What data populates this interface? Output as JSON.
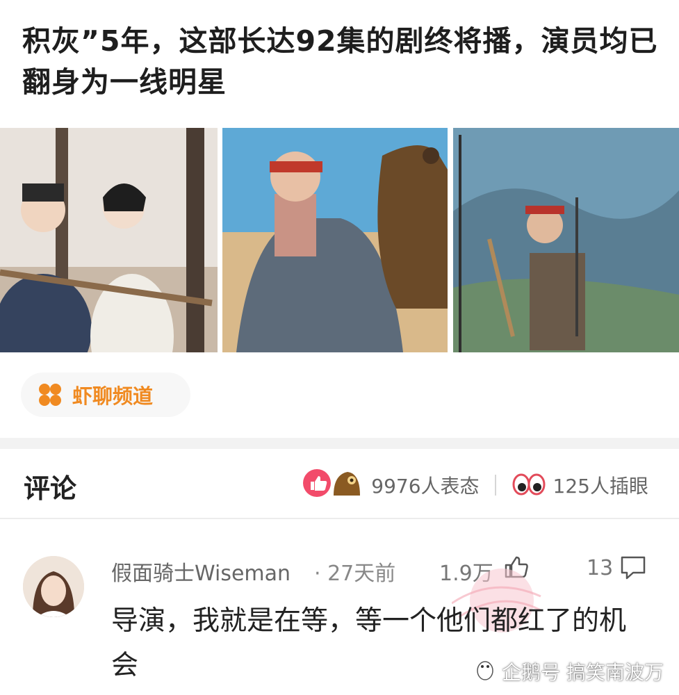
{
  "article": {
    "title": "积灰”5年，这部长达92集的剧终将播，演员均已翻身为一线明星"
  },
  "gallery": {
    "photos": [
      "photo-duo-armor",
      "photo-eagle-warrior",
      "photo-mountain-archer"
    ]
  },
  "channel": {
    "name": "虾聊频道",
    "icon": "four-petal-icon",
    "accent": "#f08a21"
  },
  "comments_section": {
    "title": "评论",
    "reactions_text": "9976人表态",
    "pokes_text": "125人插眼",
    "reaction_color": "#f24b6a"
  },
  "comment": {
    "user": "假面骑士Wiseman",
    "time": "· 27天前",
    "likes": "1.9万",
    "replies": "13",
    "text": "导演，我就是在等，等一个他们都红了的机会"
  },
  "watermark": {
    "text": "企鹅号 搞笑南波万"
  }
}
